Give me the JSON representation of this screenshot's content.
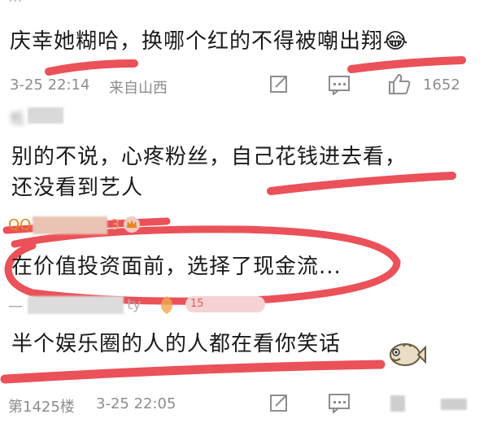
{
  "topbar": {
    "partial_text": "..."
  },
  "comment1": {
    "text": "庆幸她糊哈，换哪个红的不得被嘲出翔😂",
    "time": "3-25 22:14",
    "location": "来自山西",
    "likes": "1652"
  },
  "reply1": {
    "author_partial": "柢",
    "text_line1": "别的不说，心疼粉丝，自己花钱进去看，",
    "text_line2": "还没看到艺人"
  },
  "reply2": {
    "author_partial": "QQ",
    "author_suffix": "3",
    "text": "在价值投资面前，选择了现金流..."
  },
  "reply3": {
    "author_partial": "一",
    "author_suffix": "ty",
    "level_badge": "15",
    "text": "半个娱乐圈的人的人都在看你笑话"
  },
  "footer": {
    "floor": "第1425楼",
    "time": "3-25 22:05"
  },
  "colors": {
    "mark_red": "#e8323c",
    "meta_gray": "#8d8d8d",
    "name_orange": "#e8841a"
  },
  "icons": [
    "share-icon",
    "comment-icon",
    "thumbs-up-icon",
    "crown-icon",
    "level-badge-icon",
    "fish-emoji-icon"
  ]
}
